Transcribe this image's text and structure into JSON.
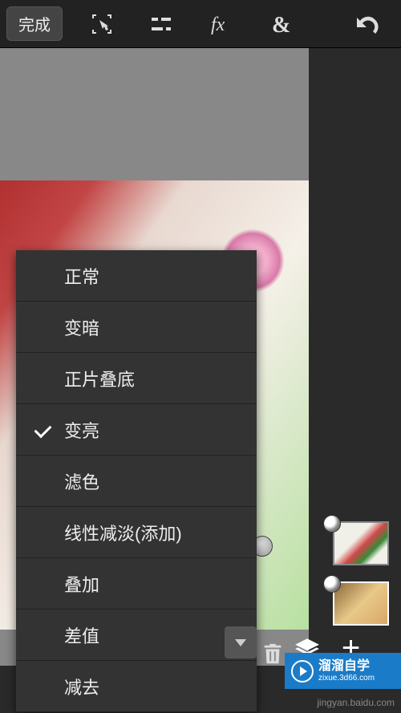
{
  "toolbar": {
    "done_label": "完成"
  },
  "blend_modes": {
    "items": [
      {
        "label": "正常",
        "selected": false
      },
      {
        "label": "变暗",
        "selected": false
      },
      {
        "label": "正片叠底",
        "selected": false
      },
      {
        "label": "变亮",
        "selected": true
      },
      {
        "label": "滤色",
        "selected": false
      },
      {
        "label": "线性减淡(添加)",
        "selected": false
      },
      {
        "label": "叠加",
        "selected": false
      },
      {
        "label": "差值",
        "selected": false
      },
      {
        "label": "减去",
        "selected": false
      }
    ]
  },
  "watermark": {
    "title": "溜溜自学",
    "url": "zixue.3d66.com"
  },
  "attribution": "jingyan.baidu.com"
}
